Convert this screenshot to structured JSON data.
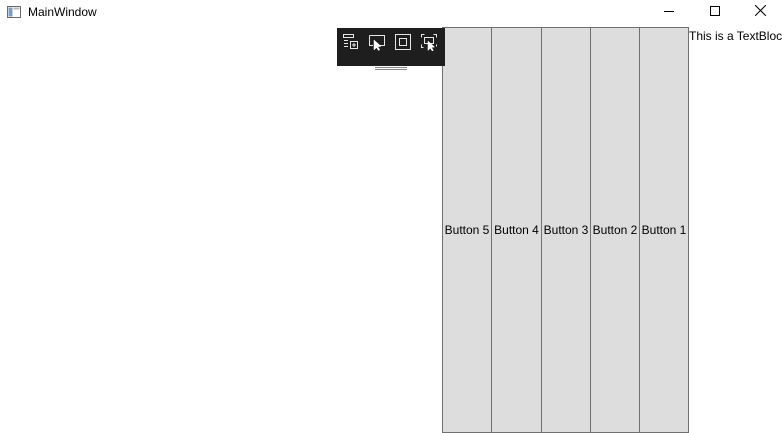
{
  "window": {
    "title": "MainWindow"
  },
  "title_bar": {
    "icon": "app-window-icon",
    "minimize_icon": "minimize-icon",
    "maximize_icon": "maximize-icon",
    "close_icon": "close-icon"
  },
  "debug_toolbar": {
    "buttons": [
      {
        "icon": "live-visual-tree-icon"
      },
      {
        "icon": "select-element-icon"
      },
      {
        "icon": "display-layout-adorners-icon"
      },
      {
        "icon": "track-focused-element-icon"
      }
    ],
    "background": "#1e1e1e"
  },
  "buttons": [
    {
      "label": "Button 5"
    },
    {
      "label": "Button 4"
    },
    {
      "label": "Button 3"
    },
    {
      "label": "Button 2"
    },
    {
      "label": "Button 1"
    }
  ],
  "textblock": {
    "text": "This is a TextBlock"
  },
  "colors": {
    "button_background": "#dddddd",
    "button_border": "#707070",
    "window_background": "#ffffff"
  }
}
